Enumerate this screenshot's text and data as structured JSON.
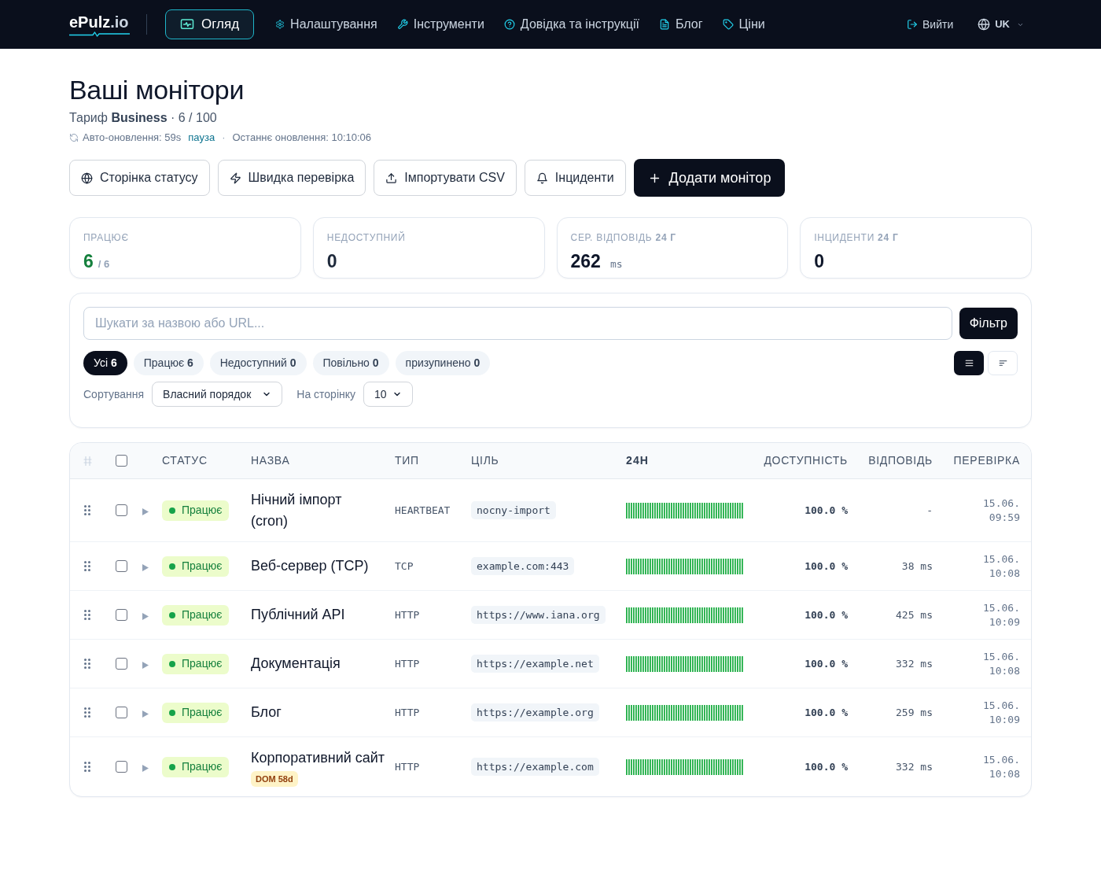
{
  "nav": {
    "logo": {
      "name": "ePulz",
      "suffix": ".io"
    },
    "items": [
      {
        "label": "Огляд",
        "selected": true
      },
      {
        "label": "Налаштування",
        "selected": false
      },
      {
        "label": "Інструменти",
        "selected": false
      },
      {
        "label": "Довідка та інструкції",
        "selected": false
      },
      {
        "label": "Блог",
        "selected": false
      },
      {
        "label": "Ціни",
        "selected": false
      }
    ],
    "logout": "Вийти",
    "language": "UK"
  },
  "header": {
    "title": "Ваші монітори",
    "plan": "Тариф **Business** · 6 / 100",
    "auto_refresh": "Авто-оновлення: 59s",
    "pause_link": "пауза",
    "separator": "·",
    "last_update": "Останнє оновлення: 10:10:06"
  },
  "actions": [
    {
      "label": "Сторінка статусу",
      "kind": "secondary"
    },
    {
      "label": "Швидка перевірка",
      "kind": "secondary"
    },
    {
      "label": "Імпортувати CSV",
      "kind": "secondary"
    },
    {
      "label": "Інциденти",
      "kind": "secondary"
    },
    {
      "label": "Додати монітор",
      "kind": "primary"
    }
  ],
  "stats": [
    {
      "label": "ПРАЦЮЄ",
      "value": "6",
      "color": "#15803d",
      "suffix": "/ 6"
    },
    {
      "label": "НЕДОСТУПНИЙ",
      "value": "0",
      "color": "#1e293b"
    },
    {
      "label": "СЕР. ВІДПОВІДЬ **24 Г**",
      "value": "262",
      "color": "#0f172a",
      "unit": "ms"
    },
    {
      "label": "ІНЦИДЕНТИ **24 Г**",
      "value": "0",
      "color": "#0f172a"
    }
  ],
  "filters": {
    "search": {
      "placeholder": "Шукати за назвою або URL..."
    },
    "filter_button": "Фільтр",
    "chips": [
      {
        "label": "Усі",
        "count": "6",
        "selected": true
      },
      {
        "label": "Працює",
        "count": "6",
        "selected": false
      },
      {
        "label": "Недоступний",
        "count": "0",
        "selected": false
      },
      {
        "label": "Повільно",
        "count": "0",
        "selected": false
      },
      {
        "label": "призупинено",
        "count": "0",
        "selected": false
      }
    ],
    "view_toggle": [
      {
        "kind": "list",
        "selected": true
      },
      {
        "kind": "compact",
        "selected": false
      }
    ],
    "sort": {
      "label": "Сортування",
      "value": "Власний порядок"
    },
    "per_page": {
      "label": "На сторінку",
      "value": "10"
    }
  },
  "table": {
    "select_all": {
      "checked": false
    },
    "columns": [
      "СТАТУС",
      "НАЗВА",
      "ТИП",
      "ЦІЛЬ",
      "24H",
      "ДОСТУПНІСТЬ",
      "ВІДПОВІДЬ",
      "ПЕРЕВІРКА"
    ],
    "rows": [
      {
        "checked": false,
        "expanded": false,
        "status": {
          "label": "Працює",
          "kind": "up"
        },
        "name": "Нічний імпорт (cron)",
        "type": "HEARTBEAT",
        "target": "nocny-import",
        "availability": "100.0 %",
        "response": "-",
        "last_check": "15.06. 09:59"
      },
      {
        "checked": false,
        "expanded": false,
        "status": {
          "label": "Працює",
          "kind": "up"
        },
        "name": "Веб-сервер (TCP)",
        "type": "TCP",
        "target": "example.com:443",
        "availability": "100.0 %",
        "response": "38 ms",
        "last_check": "15.06. 10:08"
      },
      {
        "checked": false,
        "expanded": false,
        "status": {
          "label": "Працює",
          "kind": "up"
        },
        "name": "Публічний API",
        "type": "HTTP",
        "target": "https://www.iana.org",
        "availability": "100.0 %",
        "response": "425 ms",
        "last_check": "15.06. 10:09"
      },
      {
        "checked": false,
        "expanded": false,
        "status": {
          "label": "Працює",
          "kind": "up"
        },
        "name": "Документація",
        "type": "HTTP",
        "target": "https://example.net",
        "availability": "100.0 %",
        "response": "332 ms",
        "last_check": "15.06. 10:08"
      },
      {
        "checked": false,
        "expanded": false,
        "status": {
          "label": "Працює",
          "kind": "up"
        },
        "name": "Блог",
        "type": "HTTP",
        "target": "https://example.org",
        "availability": "100.0 %",
        "response": "259 ms",
        "last_check": "15.06. 10:09"
      },
      {
        "checked": false,
        "expanded": false,
        "status": {
          "label": "Працює",
          "kind": "up"
        },
        "name": "Корпоративний сайт",
        "badge": "DOM 58d",
        "type": "HTTP",
        "target": "https://example.com",
        "availability": "100.0 %",
        "response": "332 ms",
        "last_check": "15.06. 10:08"
      }
    ]
  }
}
